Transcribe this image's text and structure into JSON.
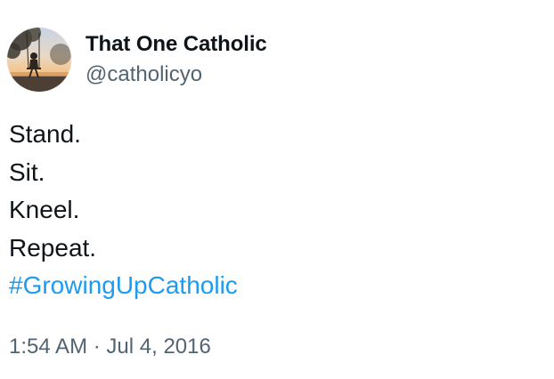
{
  "author": {
    "display_name": "That One Catholic",
    "handle": "@catholicyo",
    "avatar_icon": "profile-photo"
  },
  "tweet": {
    "lines": [
      "Stand.",
      "Sit.",
      "Kneel.",
      "Repeat."
    ],
    "hashtag": "#GrowingUpCatholic",
    "time": "1:54 AM",
    "separator": "·",
    "date": "Jul 4, 2016"
  },
  "colors": {
    "text": "#0f1419",
    "secondary": "#536471",
    "link": "#1d9bf0",
    "background": "#ffffff"
  }
}
